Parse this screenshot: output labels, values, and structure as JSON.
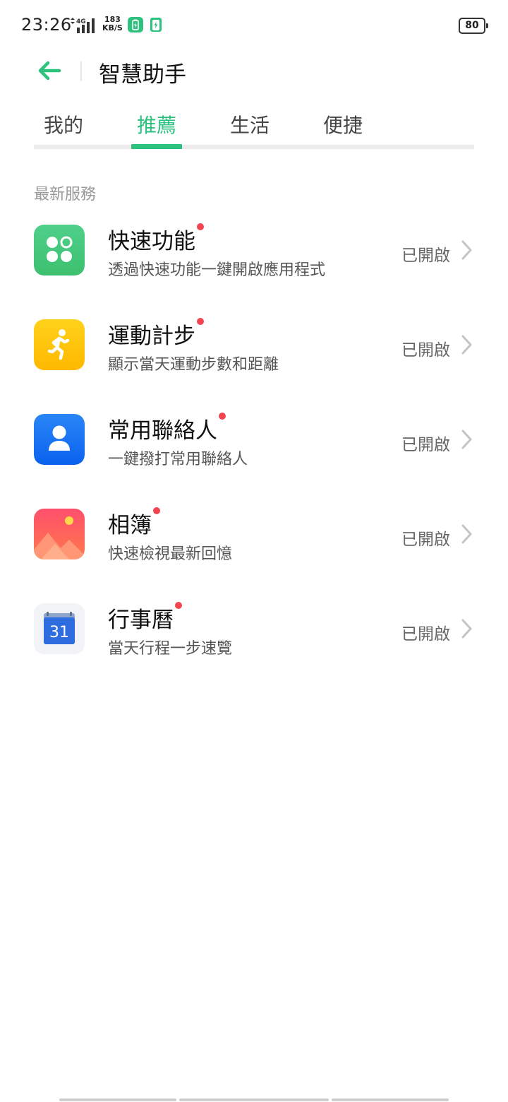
{
  "status_bar": {
    "time": "23:26",
    "network": "4G",
    "speed_value": "183",
    "speed_unit": "KB/S",
    "battery": "80",
    "app_icon_colors": [
      "#2ec27e",
      "#2ec27e"
    ]
  },
  "header": {
    "back_icon": "arrow-left-icon",
    "title": "智慧助手",
    "accent_color": "#2ec27e"
  },
  "tabs": [
    {
      "label": "我的",
      "active": false
    },
    {
      "label": "推薦",
      "active": true
    },
    {
      "label": "生活",
      "active": false
    },
    {
      "label": "便捷",
      "active": false
    }
  ],
  "section": {
    "label": "最新服務"
  },
  "services": [
    {
      "title": "快速功能",
      "description": "透過快速功能一鍵開啟應用程式",
      "status": "已開啟",
      "icon": "quick-function-icon",
      "new": true
    },
    {
      "title": "運動計步",
      "description": "顯示當天運動步數和距離",
      "status": "已開啟",
      "icon": "step-counter-icon",
      "new": true
    },
    {
      "title": "常用聯絡人",
      "description": "一鍵撥打常用聯絡人",
      "status": "已開啟",
      "icon": "contacts-icon",
      "new": true
    },
    {
      "title": "相簿",
      "description": "快速檢視最新回憶",
      "status": "已開啟",
      "icon": "photos-icon",
      "new": true
    },
    {
      "title": "行事曆",
      "description": "當天行程一步速覽",
      "status": "已開啟",
      "icon": "calendar-icon",
      "new": true,
      "icon_text": "31"
    }
  ]
}
